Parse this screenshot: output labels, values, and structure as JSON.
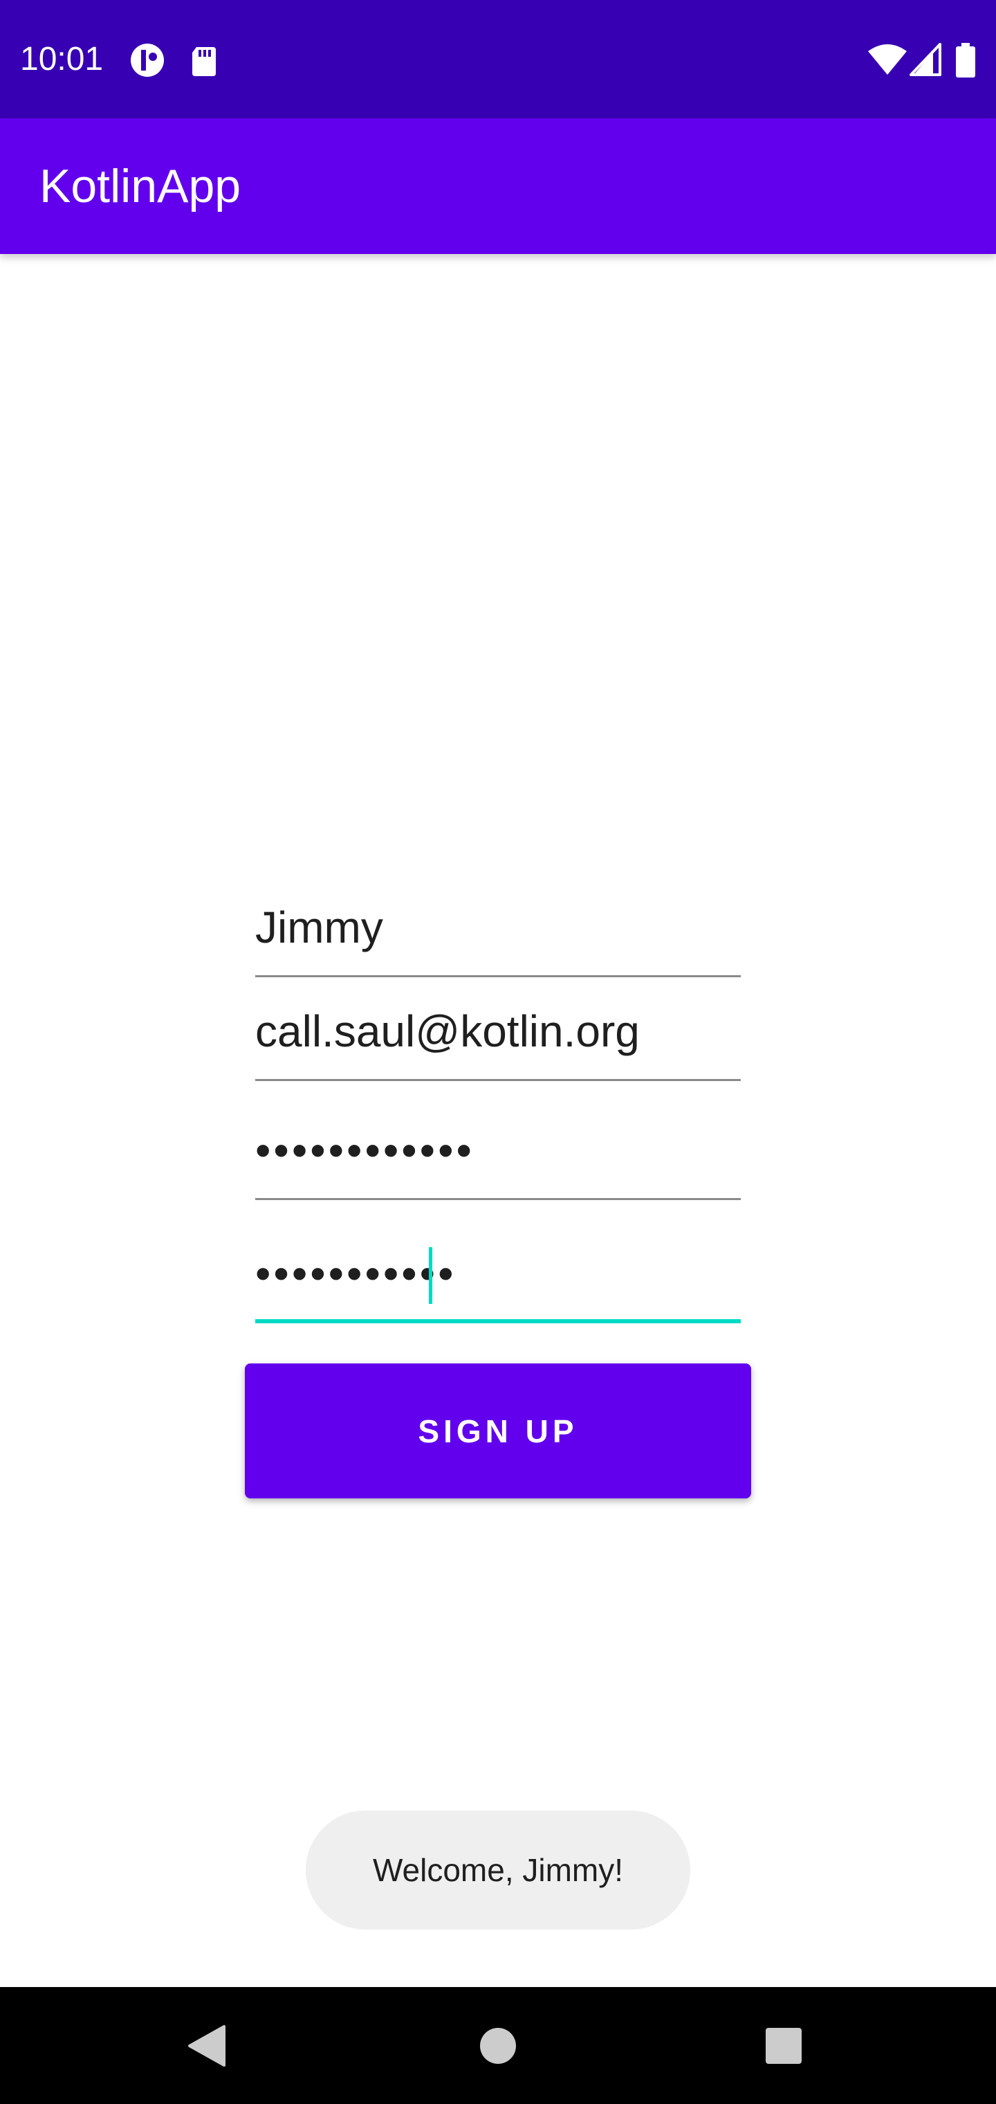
{
  "status_bar": {
    "time": "10:01",
    "left_icons": [
      "notification-circle-icon",
      "sd-card-icon"
    ],
    "right_icons": [
      "wifi-icon",
      "cellular-signal-icon",
      "battery-icon"
    ]
  },
  "app_bar": {
    "title": "KotlinApp"
  },
  "form": {
    "name_value": "Jimmy",
    "email_value": "call.saul@kotlin.org",
    "password_value": "••••••••••••",
    "confirm_password_value": "•••••••••••",
    "submit_label": "SIGN UP"
  },
  "toast": {
    "message": "Welcome, Jimmy!"
  },
  "nav_bar": {
    "buttons": [
      "back-icon",
      "home-icon",
      "recents-icon"
    ]
  },
  "colors": {
    "status_bar": "#3700b3",
    "primary": "#6200ee",
    "accent": "#03dac5",
    "toast_bg": "#efefef"
  }
}
